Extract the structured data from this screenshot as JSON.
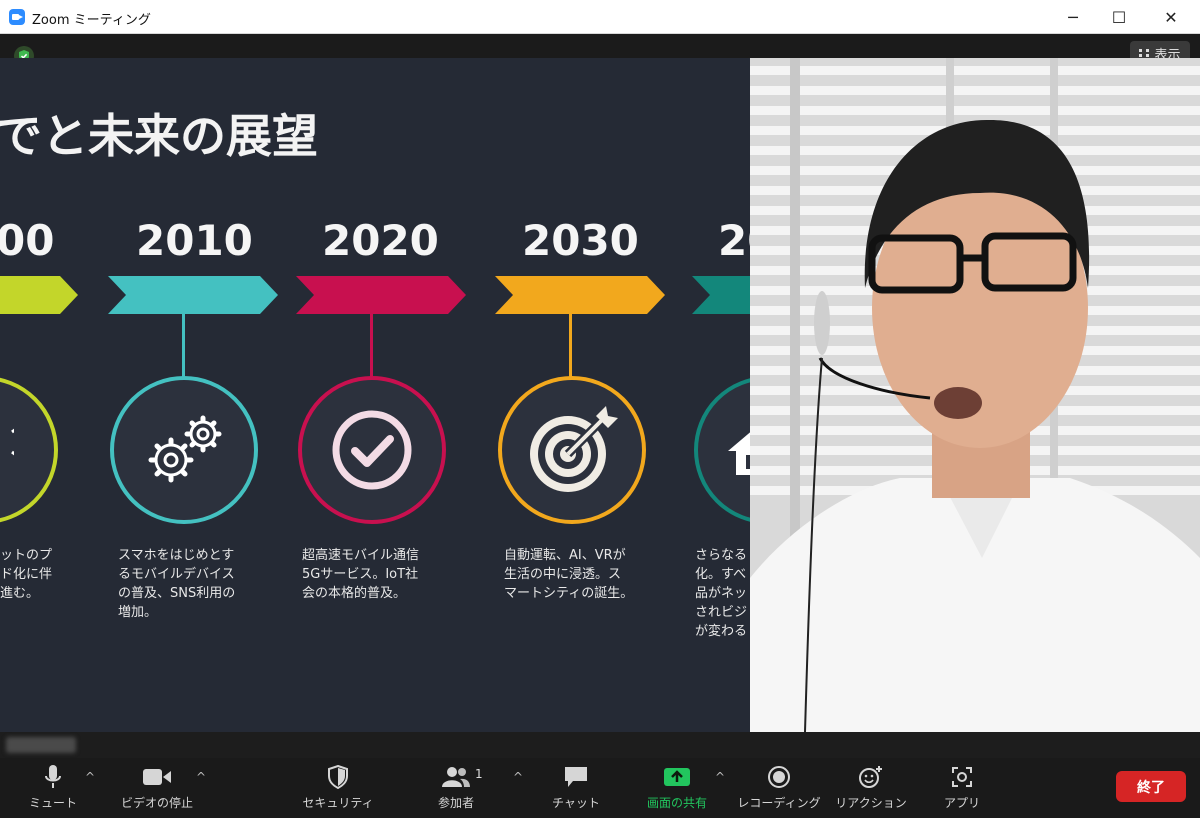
{
  "window": {
    "title": "Zoom ミーティング",
    "minimize": "─",
    "maximize": "☐",
    "close": "✕"
  },
  "view_button": {
    "label": "表示"
  },
  "slide": {
    "title": "でと未来の展望",
    "items": [
      {
        "year": "00",
        "color": "#c3d62a",
        "desc": "ットのプ\nド化に伴\n進む。",
        "icon": "lightbulb-icon"
      },
      {
        "year": "2010",
        "color": "#44c1c1",
        "desc": "スマホをはじめとす\nるモバイルデバイス\nの普及、SNS利用の\n増加。",
        "icon": "gears-icon"
      },
      {
        "year": "2020",
        "color": "#c8104f",
        "desc": "超高速モバイル通信\n5Gサービス。IoT社\n会の本格的普及。",
        "icon": "check-icon"
      },
      {
        "year": "2030",
        "color": "#f2a81d",
        "desc": "自動運転、AI、VRが\n生活の中に浸透。ス\nマートシティの誕生。",
        "icon": "target-icon"
      },
      {
        "year": "20",
        "color": "#13877b",
        "desc": "さらなる\n化。すべ\n品がネッ\nされビジ\nが変わる",
        "icon": "home-icon"
      }
    ]
  },
  "toolbar": {
    "mute": "ミュート",
    "video": "ビデオの停止",
    "security": "セキュリティ",
    "participants": "参加者",
    "participants_count": "1",
    "chat": "チャット",
    "share": "画面の共有",
    "record": "レコーディング",
    "reactions": "リアクション",
    "apps": "アプリ",
    "end": "終了"
  },
  "colors": {
    "share_accent": "#22c55e",
    "end_button": "#d62525",
    "slide_bg": "#252a35"
  }
}
